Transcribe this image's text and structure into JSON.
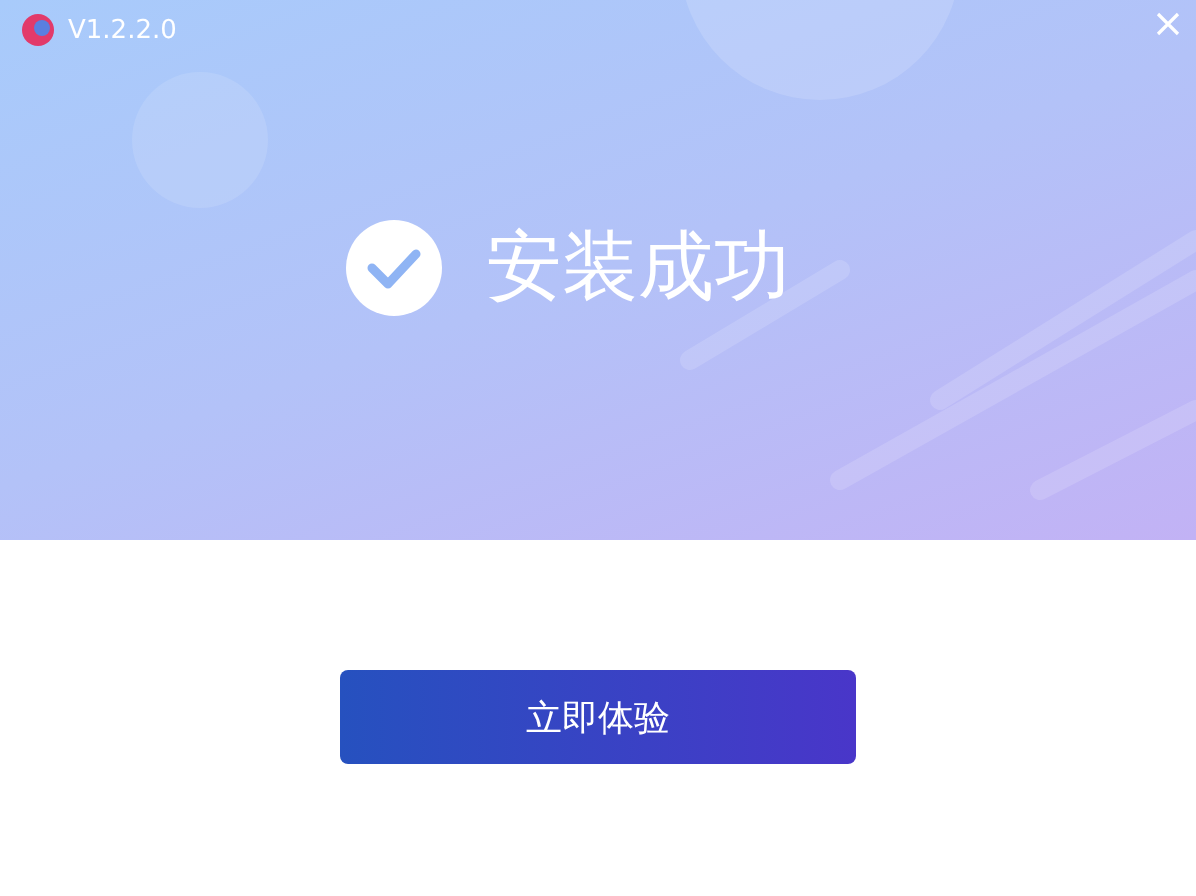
{
  "window": {
    "title": "V1.2.2.0"
  },
  "result": {
    "message": "安装成功"
  },
  "buttons": [
    {
      "label": "立即体验"
    }
  ]
}
